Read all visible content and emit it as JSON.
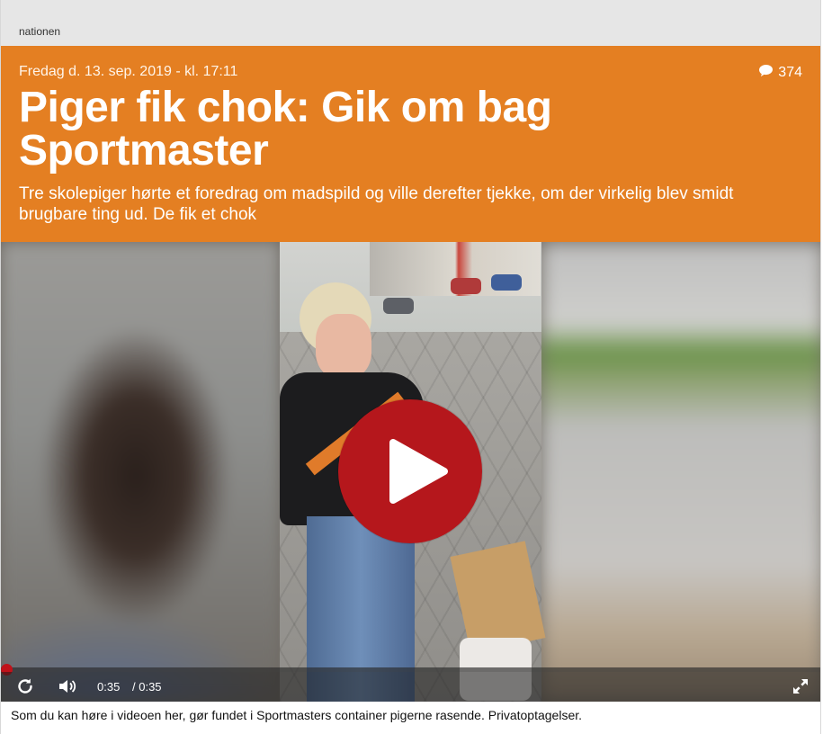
{
  "header": {
    "section": "nationen"
  },
  "article": {
    "date": "Fredag d. 13. sep. 2019 - kl. 17:11",
    "comment_count": "374",
    "headline": "Piger fik chok: Gik om bag Sportmaster",
    "lead": "Tre skolepiger hørte et foredrag om madspild og ville derefter tjekke, om der virkelig blev smidt brugbare ting ud. De fik et chok",
    "accent_color": "#e47f22"
  },
  "video": {
    "current_time": "0:35",
    "duration": "/ 0:35",
    "progress": 0.0,
    "play_color": "#b5171c",
    "icons": [
      "play-icon",
      "replay-icon",
      "volume-icon",
      "fullscreen-icon"
    ]
  },
  "caption": "Som du kan høre i videoen her, gør fundet i Sportmasters container pigerne rasende. Privatoptagelser."
}
